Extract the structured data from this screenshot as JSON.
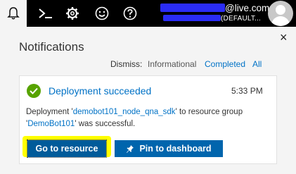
{
  "topbar": {
    "icons": [
      "bell-icon",
      "cloud-shell-icon",
      "gear-icon",
      "smiley-feedback-icon",
      "help-icon"
    ],
    "account_email_suffix": "@live.com",
    "account_directory_suffix": "(DEFAULT..."
  },
  "panel": {
    "title": "Notifications",
    "close_label": "×",
    "dismiss": {
      "label": "Dismiss:",
      "informational": "Informational",
      "completed": "Completed",
      "all": "All"
    }
  },
  "notification": {
    "title": "Deployment succeeded",
    "time": "5:33 PM",
    "message": {
      "prefix": "Deployment '",
      "deployment_name": "demobot101_node_qna_sdk",
      "middle": "' to resource group '",
      "resource_group": "DemoBot101",
      "suffix": "' was successful."
    },
    "actions": {
      "go_to_resource": "Go to resource",
      "pin_to_dashboard": "Pin to dashboard"
    }
  },
  "colors": {
    "success": "#57a300",
    "link": "#0072c6",
    "button": "#0065ad",
    "highlight": "#ffff00",
    "redaction": "#2a2cf5"
  }
}
